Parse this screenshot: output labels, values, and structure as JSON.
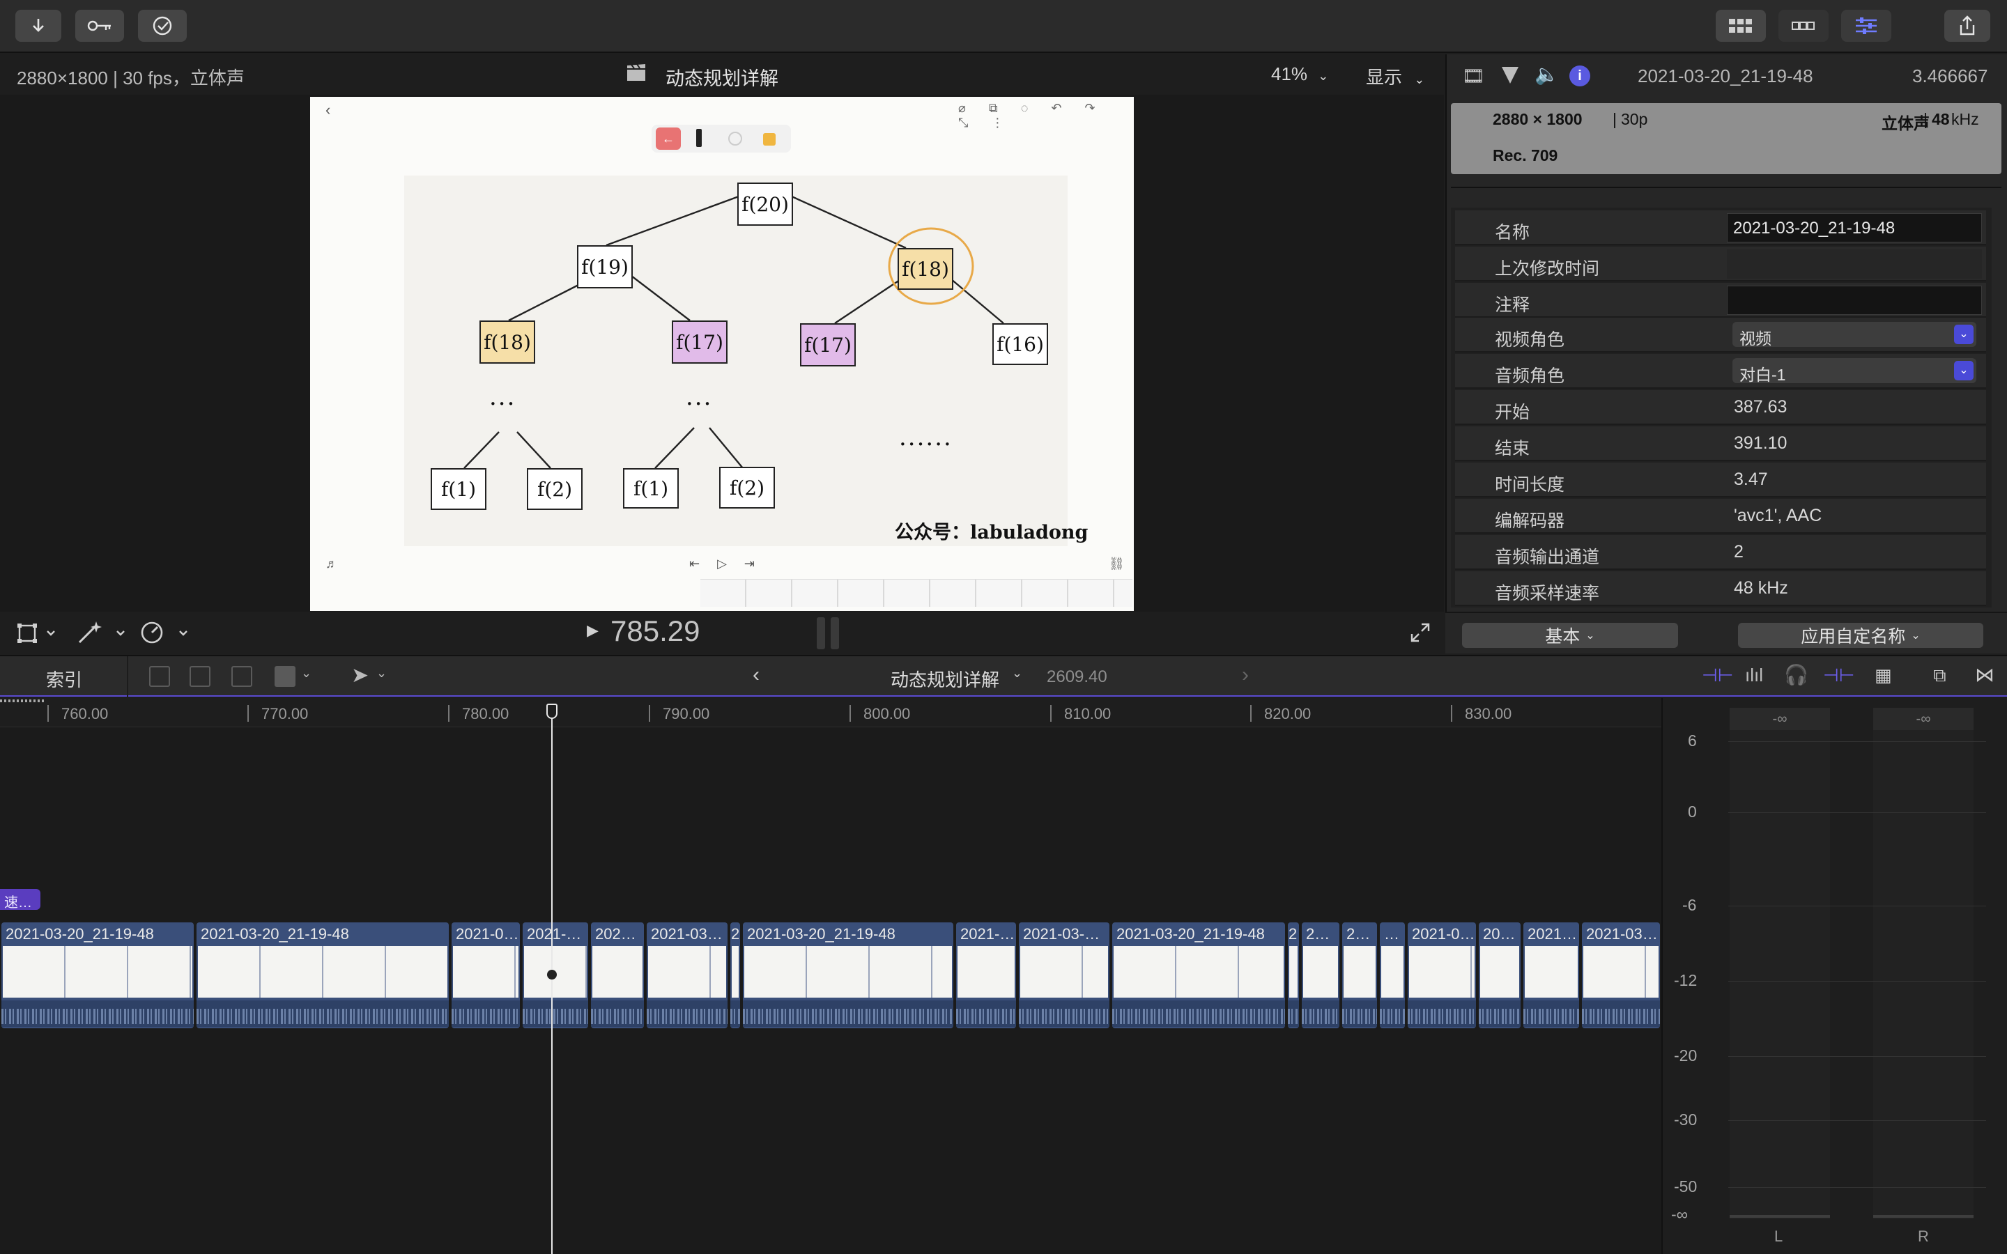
{
  "toolbar": {
    "import_icon": "download-arrow-icon",
    "keyword_icon": "key-icon",
    "analyze_icon": "checkmark-circle-icon",
    "right_icons": [
      "grid-view-icon",
      "filmstrip-view-icon",
      "inspector-sliders-icon",
      "share-icon"
    ]
  },
  "viewer": {
    "format": "2880×1800 | 30 fps，立体声",
    "project_title": "动态规划详解",
    "zoom": "41%",
    "display_label": "显示",
    "timecode": "785.29"
  },
  "frame": {
    "tree": {
      "root": "f(20)",
      "level1": [
        "f(19)",
        "f(18)"
      ],
      "level2": [
        "f(18)",
        "f(17)",
        "f(17)",
        "f(16)"
      ],
      "leaves": [
        "f(1)",
        "f(2)",
        "f(1)",
        "f(2)"
      ],
      "ellipsis_short": "···",
      "ellipsis_long": "······"
    },
    "watermark": "公众号：labuladong"
  },
  "inspector": {
    "name_title": "2021-03-20_21-19-48",
    "duration_value": "3.466667",
    "summary": {
      "resolution": "2880 × 1800",
      "rate": "30p",
      "audio": "立体声",
      "sample": "48",
      "sample_unit": "kHz",
      "color_space": "Rec. 709"
    },
    "rows": [
      {
        "label": "名称",
        "value": "2021-03-20_21-19-48",
        "kind": "field"
      },
      {
        "label": "上次修改时间",
        "value": "",
        "kind": "text"
      },
      {
        "label": "注释",
        "value": "",
        "kind": "field"
      },
      {
        "label": "视频角色",
        "value": "视频",
        "kind": "dropdown"
      },
      {
        "label": "音频角色",
        "value": "对白-1",
        "kind": "dropdown"
      },
      {
        "label": "开始",
        "value": "387.63",
        "kind": "text"
      },
      {
        "label": "结束",
        "value": "391.10",
        "kind": "text"
      },
      {
        "label": "时间长度",
        "value": "3.47",
        "kind": "text"
      },
      {
        "label": "编解码器",
        "value": "'avc1', AAC",
        "kind": "text"
      },
      {
        "label": "音频输出通道",
        "value": "2",
        "kind": "text"
      },
      {
        "label": "音频采样速率",
        "value": "48 kHz",
        "kind": "text"
      }
    ],
    "footer": {
      "basic": "基本",
      "apply_names": "应用自定名称"
    }
  },
  "timeline": {
    "index_label": "索引",
    "project_title": "动态规划详解",
    "project_duration": "2609.40",
    "ruler": [
      "760.00",
      "770.00",
      "780.00",
      "790.00",
      "800.00",
      "810.00",
      "820.00",
      "830.00"
    ],
    "speed_badge": "速…",
    "clips": [
      "2021-03-20_21-19-48",
      "2021-03-20_21-19-48",
      "2021-0…",
      "2021-…",
      "202…",
      "2021-03…",
      "2",
      "2021-03-20_21-19-48",
      "2021-…",
      "2021-03-…",
      "2021-03-20_21-19-48",
      "2",
      "2…",
      "2…",
      "…",
      "2021-0…",
      "20…",
      "2021…",
      "2021-03…"
    ]
  },
  "meters": {
    "scale": [
      "6",
      "0",
      "-6",
      "-12",
      "-20",
      "-30",
      "-50",
      "-∞"
    ],
    "peak_left": "-∞",
    "peak_right": "-∞",
    "channel_left": "L",
    "channel_right": "R"
  }
}
